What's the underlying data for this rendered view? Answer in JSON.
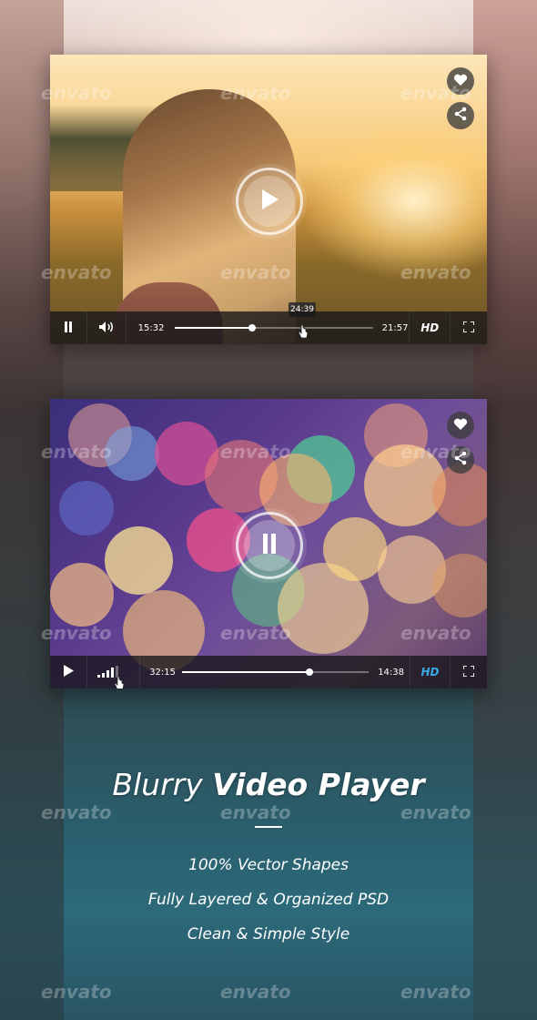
{
  "watermark": "envato",
  "players": [
    {
      "scene": "girl-sunset",
      "state": "paused",
      "current_time": "15:32",
      "total_time": "21:57",
      "hover_time": "24:39",
      "progress": 0.39,
      "hd_label": "HD",
      "hd_color": "#ffffff"
    },
    {
      "scene": "bokeh",
      "state": "playing",
      "current_time": "32:15",
      "total_time": "14:38",
      "progress": 0.68,
      "hd_label": "HD",
      "hd_color": "#39a8e6"
    }
  ],
  "headline": {
    "light": "Blurry",
    "bold": "Video Player"
  },
  "features": [
    "100% Vector Shapes",
    "Fully Layered & Organized PSD",
    "Clean & Simple Style"
  ],
  "icons": [
    "heart-icon",
    "share-icon",
    "play-icon",
    "pause-icon",
    "volume-icon",
    "signal-volume-icon",
    "fullscreen-icon",
    "cursor-icon"
  ]
}
